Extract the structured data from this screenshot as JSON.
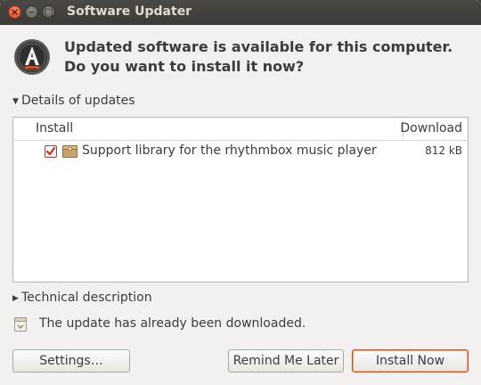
{
  "window": {
    "title": "Software Updater",
    "close_glyph": "×",
    "min_glyph": "–",
    "max_glyph": "□"
  },
  "header": {
    "icon": "software-updater-icon",
    "headline": "Updated software is available for this computer. Do you want to install it now?"
  },
  "details": {
    "label": "Details of updates",
    "expanded": true,
    "columns": {
      "install": "Install",
      "download": "Download"
    },
    "rows": [
      {
        "checked": true,
        "icon": "package-icon",
        "label": "Support library for the rhythmbox music player",
        "size": "812 kB"
      }
    ]
  },
  "technical": {
    "label": "Technical description",
    "expanded": false
  },
  "status": {
    "icon": "info-icon",
    "text": "The update has already been downloaded."
  },
  "buttons": {
    "settings": "Settings…",
    "remind": "Remind Me Later",
    "install": "Install Now"
  },
  "colors": {
    "accent": "#dd4814",
    "titlebar": "#3c3b37",
    "window_bg": "#f2f1f0"
  }
}
